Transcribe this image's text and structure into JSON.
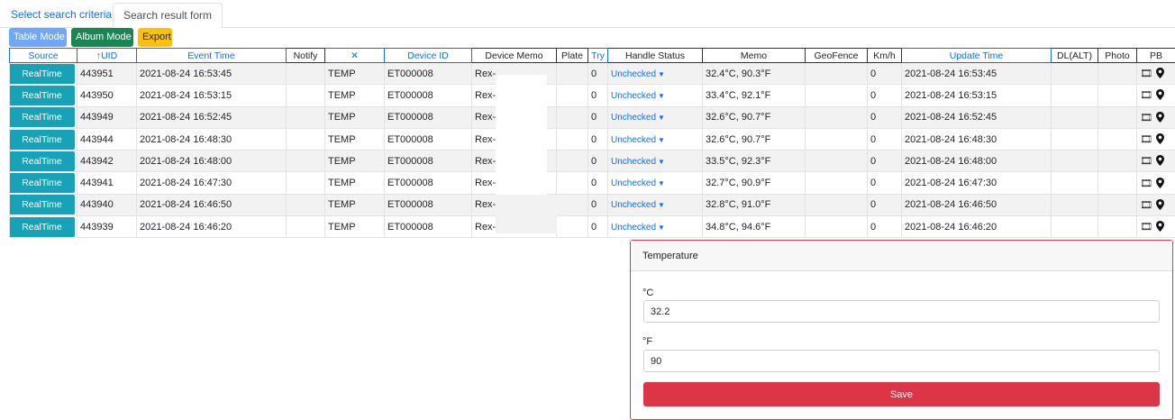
{
  "tabs": [
    {
      "label": "Select search criteria",
      "active": false
    },
    {
      "label": "Search result form",
      "active": true
    }
  ],
  "toolbar": {
    "table_mode": "Table Mode",
    "album_mode": "Album Mode",
    "export": "Export"
  },
  "table": {
    "headers": {
      "source": "Source",
      "uid": "UID",
      "uid_sort": "↑",
      "event_time": "Event Time",
      "notify": "Notify",
      "type": "✕",
      "device_id": "Device ID",
      "device_memo": "Device Memo",
      "plate": "Plate",
      "try": "Try",
      "handle_status": "Handle Status",
      "memo": "Memo",
      "geofence": "GeoFence",
      "kmh": "Km/h",
      "update_time": "Update Time",
      "dl": "DL(ALT)",
      "photo": "Photo",
      "pb": "PB"
    },
    "rows": [
      {
        "source": "RealTime",
        "uid": "443951",
        "event_time": "2021-08-24 16:53:45",
        "notify": "",
        "type": "TEMP",
        "device_id": "ET000008",
        "device_memo": "Rex-",
        "plate": "",
        "try": "0",
        "handle_status": "Unchecked",
        "memo": "32.4°C, 90.3°F",
        "geofence": "",
        "kmh": "0",
        "update_time": "2021-08-24 16:53:45",
        "dl": "",
        "photo": ""
      },
      {
        "source": "RealTime",
        "uid": "443950",
        "event_time": "2021-08-24 16:53:15",
        "notify": "",
        "type": "TEMP",
        "device_id": "ET000008",
        "device_memo": "Rex-",
        "plate": "",
        "try": "0",
        "handle_status": "Unchecked",
        "memo": "33.4°C, 92.1°F",
        "geofence": "",
        "kmh": "0",
        "update_time": "2021-08-24 16:53:15",
        "dl": "",
        "photo": ""
      },
      {
        "source": "RealTime",
        "uid": "443949",
        "event_time": "2021-08-24 16:52:45",
        "notify": "",
        "type": "TEMP",
        "device_id": "ET000008",
        "device_memo": "Rex-",
        "plate": "",
        "try": "0",
        "handle_status": "Unchecked",
        "memo": "32.6°C, 90.7°F",
        "geofence": "",
        "kmh": "0",
        "update_time": "2021-08-24 16:52:45",
        "dl": "",
        "photo": ""
      },
      {
        "source": "RealTime",
        "uid": "443944",
        "event_time": "2021-08-24 16:48:30",
        "notify": "",
        "type": "TEMP",
        "device_id": "ET000008",
        "device_memo": "Rex-",
        "plate": "",
        "try": "0",
        "handle_status": "Unchecked",
        "memo": "32.6°C, 90.7°F",
        "geofence": "",
        "kmh": "0",
        "update_time": "2021-08-24 16:48:30",
        "dl": "",
        "photo": ""
      },
      {
        "source": "RealTime",
        "uid": "443942",
        "event_time": "2021-08-24 16:48:00",
        "notify": "",
        "type": "TEMP",
        "device_id": "ET000008",
        "device_memo": "Rex-",
        "plate": "",
        "try": "0",
        "handle_status": "Unchecked",
        "memo": "33.5°C, 92.3°F",
        "geofence": "",
        "kmh": "0",
        "update_time": "2021-08-24 16:48:00",
        "dl": "",
        "photo": ""
      },
      {
        "source": "RealTime",
        "uid": "443941",
        "event_time": "2021-08-24 16:47:30",
        "notify": "",
        "type": "TEMP",
        "device_id": "ET000008",
        "device_memo": "Rex-",
        "plate": "",
        "try": "0",
        "handle_status": "Unchecked",
        "memo": "32.7°C, 90.9°F",
        "geofence": "",
        "kmh": "0",
        "update_time": "2021-08-24 16:47:30",
        "dl": "",
        "photo": ""
      },
      {
        "source": "RealTime",
        "uid": "443940",
        "event_time": "2021-08-24 16:46:50",
        "notify": "",
        "type": "TEMP",
        "device_id": "ET000008",
        "device_memo": "Rex-",
        "plate": "",
        "try": "0",
        "handle_status": "Unchecked",
        "memo": "32.8°C, 91.0°F",
        "geofence": "",
        "kmh": "0",
        "update_time": "2021-08-24 16:46:50",
        "dl": "",
        "photo": ""
      },
      {
        "source": "RealTime",
        "uid": "443939",
        "event_time": "2021-08-24 16:46:20",
        "notify": "",
        "type": "TEMP",
        "device_id": "ET000008",
        "device_memo": "Rex-",
        "plate": "",
        "try": "0",
        "handle_status": "Unchecked",
        "memo": "34.8°C, 94.6°F",
        "geofence": "",
        "kmh": "0",
        "update_time": "2021-08-24 16:46:20",
        "dl": "",
        "photo": ""
      }
    ],
    "pb_icons": [
      "film-icon",
      "map-marker-icon"
    ]
  },
  "temperature_panel": {
    "title": "Temperature",
    "celsius_label": "°C",
    "celsius_value": "32.2",
    "fahrenheit_label": "°F",
    "fahrenheit_value": "90",
    "save_label": "Save"
  },
  "colors": {
    "accent_blue": "#0d6efd",
    "realtime_button": "#17a2b8",
    "album_button": "#198754",
    "export_button": "#ffc107",
    "danger": "#dc3545"
  }
}
